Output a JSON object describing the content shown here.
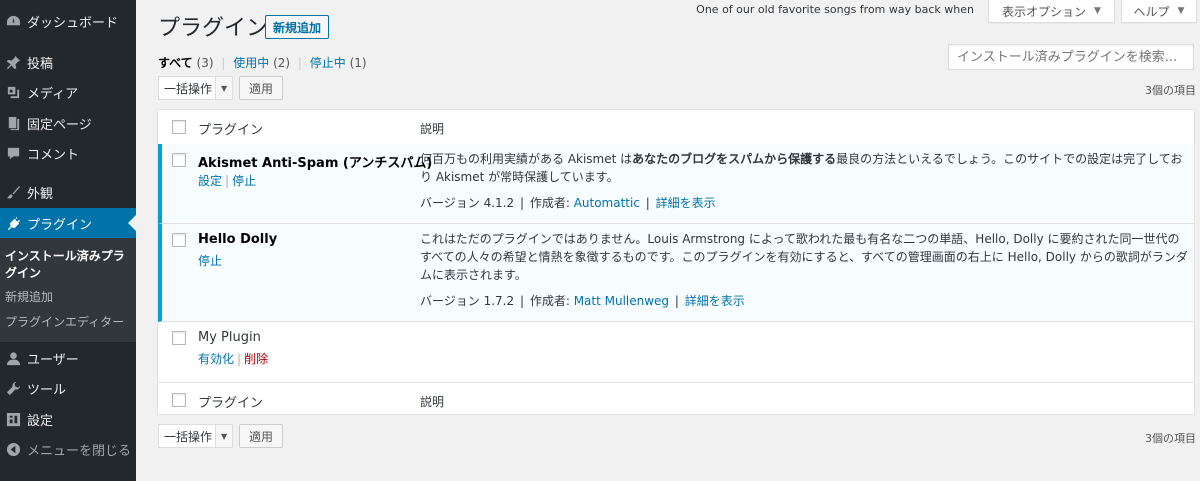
{
  "sidebar": {
    "items": [
      {
        "label": "ダッシュボード",
        "icon": "dashboard-icon"
      },
      {
        "label": "投稿",
        "icon": "pin-icon"
      },
      {
        "label": "メディア",
        "icon": "media-icon"
      },
      {
        "label": "固定ページ",
        "icon": "page-icon"
      },
      {
        "label": "コメント",
        "icon": "comment-icon"
      },
      {
        "label": "外観",
        "icon": "brush-icon"
      },
      {
        "label": "プラグイン",
        "icon": "plugin-icon"
      },
      {
        "label": "ユーザー",
        "icon": "user-icon"
      },
      {
        "label": "ツール",
        "icon": "wrench-icon"
      },
      {
        "label": "設定",
        "icon": "settings-icon"
      },
      {
        "label": "メニューを閉じる",
        "icon": "collapse-icon"
      }
    ],
    "submenu": [
      {
        "label": "インストール済みプラグイン"
      },
      {
        "label": "新規追加"
      },
      {
        "label": "プラグインエディター"
      }
    ]
  },
  "top": {
    "song": "One of our old favorite songs from way back when",
    "screen_options": "表示オプション",
    "help": "ヘルプ"
  },
  "page": {
    "title": "プラグイン",
    "add_new": "新規追加",
    "search_placeholder": "インストール済みプラグインを検索..."
  },
  "filters": {
    "all": "すべて",
    "all_count": "(3)",
    "active": "使用中",
    "active_count": "(2)",
    "inactive": "停止中",
    "inactive_count": "(1)",
    "sep": "|"
  },
  "bulk": {
    "select": "一括操作",
    "apply": "適用"
  },
  "item_count": "3個の項目",
  "table": {
    "col_plugin": "プラグイン",
    "col_desc": "説明",
    "rows": [
      {
        "name": "Akismet Anti-Spam (アンチスパム)",
        "actions": [
          "設定",
          "停止"
        ],
        "desc_1": "何百万もの利用実績がある Akismet は",
        "desc_bold": "あなたのブログをスパムから保護する",
        "desc_2": "最良の方法といえるでしょう。このサイトでの設定は完了しており Akismet が常時保護しています。",
        "version": "バージョン 4.1.2",
        "author_label": "作成者:",
        "author": "Automattic",
        "details": "詳細を表示"
      },
      {
        "name": "Hello Dolly",
        "actions": [
          "停止"
        ],
        "desc": "これはただのプラグインではありません。Louis Armstrong によって歌われた最も有名な二つの単語、Hello, Dolly に要約された同一世代のすべての人々の希望と情熱を象徴するものです。このプラグインを有効にすると、すべての管理画面の右上に Hello, Dolly からの歌詞がランダムに表示されます。",
        "version": "バージョン 1.7.2",
        "author_label": "作成者:",
        "author": "Matt Mullenweg",
        "details": "詳細を表示"
      },
      {
        "name": "My Plugin",
        "actions": [
          "有効化",
          "削除"
        ]
      }
    ]
  },
  "colors": {
    "sidebar_bg": "#23282d",
    "accent": "#0073aa",
    "active_row_border": "#00a0d2",
    "delete": "#a00"
  }
}
